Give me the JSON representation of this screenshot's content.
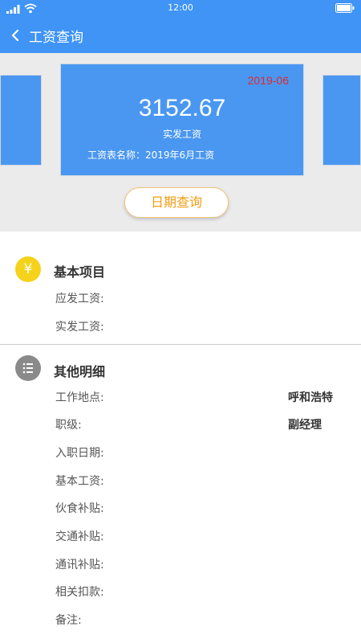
{
  "status_bar": {
    "time": "12:00"
  },
  "navbar": {
    "title": "工资查询"
  },
  "salary_card": {
    "period": "2019-06",
    "amount": "3152.67",
    "amount_label": "实发工资",
    "sheet_name": "工资表名称：2019年6月工资"
  },
  "date_query_button": "日期查询",
  "basic_section": {
    "title": "基本项目",
    "icon_glyph": "¥",
    "icon_color": "#f5d31c",
    "rows": [
      {
        "label": "应发工资:"
      },
      {
        "label": "实发工资:"
      }
    ]
  },
  "detail_section": {
    "title": "其他明细",
    "icon_color": "#8a8a8a",
    "rows": [
      {
        "label": "工作地点:",
        "value": "呼和浩特"
      },
      {
        "label": "职级:",
        "value": "副经理"
      },
      {
        "label": "入职日期:"
      },
      {
        "label": "基本工资:"
      },
      {
        "label": "伙食补贴:"
      },
      {
        "label": "交通补贴:"
      },
      {
        "label": "通讯补贴:"
      },
      {
        "label": "相关扣款:"
      },
      {
        "label": "备注:"
      }
    ]
  },
  "colors": {
    "primary": "#3f94f5",
    "card": "#4a97f2",
    "accent": "#f39c12",
    "period": "#e02a2a"
  }
}
